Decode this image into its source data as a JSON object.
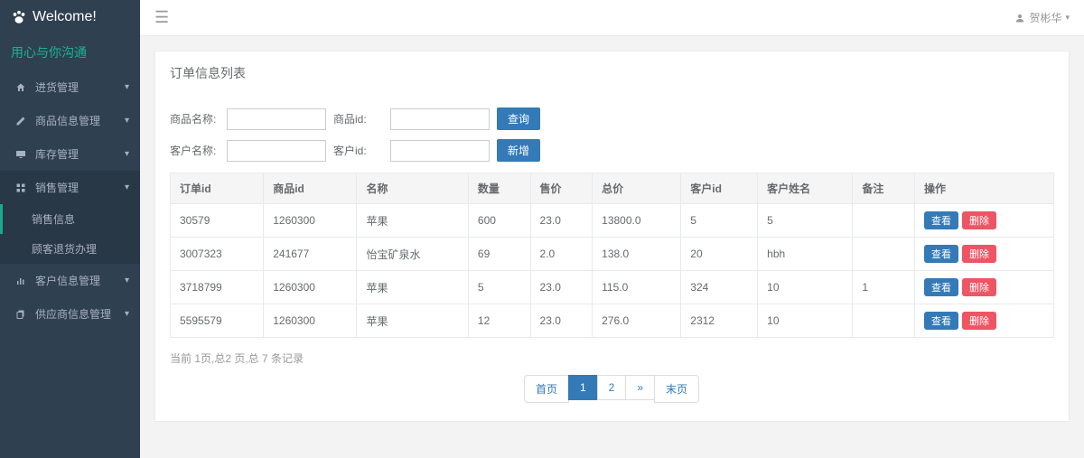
{
  "brand": {
    "title": "Welcome!",
    "tagline": "用心与你沟通"
  },
  "user": {
    "name": "贺彬华"
  },
  "nav": {
    "items": [
      {
        "label": "进货管理",
        "icon": "home"
      },
      {
        "label": "商品信息管理",
        "icon": "edit"
      },
      {
        "label": "库存管理",
        "icon": "desktop"
      },
      {
        "label": "销售管理",
        "icon": "grid",
        "expanded": true,
        "children": [
          {
            "label": "销售信息",
            "current": true
          },
          {
            "label": "顾客退货办理"
          }
        ]
      },
      {
        "label": "客户信息管理",
        "icon": "chart"
      },
      {
        "label": "供应商信息管理",
        "icon": "copy"
      }
    ]
  },
  "page": {
    "title": "订单信息列表",
    "search": {
      "row1": {
        "label1": "商品名称:",
        "label2": "商品id:",
        "button": "查询"
      },
      "row2": {
        "label1": "客户名称:",
        "label2": "客户id:",
        "button": "新增"
      }
    },
    "table": {
      "headers": [
        "订单id",
        "商品id",
        "名称",
        "数量",
        "售价",
        "总价",
        "客户id",
        "客户姓名",
        "备注",
        "操作"
      ],
      "rows": [
        {
          "c0": "30579",
          "c1": "1260300",
          "c2": "苹果",
          "c3": "600",
          "c4": "23.0",
          "c5": "13800.0",
          "c6": "5",
          "c7": "5",
          "c8": ""
        },
        {
          "c0": "3007323",
          "c1": "241677",
          "c2": "怡宝矿泉水",
          "c3": "69",
          "c4": "2.0",
          "c5": "138.0",
          "c6": "20",
          "c7": "hbh",
          "c8": ""
        },
        {
          "c0": "3718799",
          "c1": "1260300",
          "c2": "苹果",
          "c3": "5",
          "c4": "23.0",
          "c5": "115.0",
          "c6": "324",
          "c7": "10",
          "c8": "1"
        },
        {
          "c0": "5595579",
          "c1": "1260300",
          "c2": "苹果",
          "c3": "12",
          "c4": "23.0",
          "c5": "276.0",
          "c6": "2312",
          "c7": "10",
          "c8": ""
        }
      ],
      "ops": {
        "view": "查看",
        "delete": "删除"
      }
    },
    "pager": {
      "info": "当前 1页,总2 页,总 7 条记录",
      "first": "首页",
      "p1": "1",
      "p2": "2",
      "next": "»",
      "last": "末页"
    }
  }
}
